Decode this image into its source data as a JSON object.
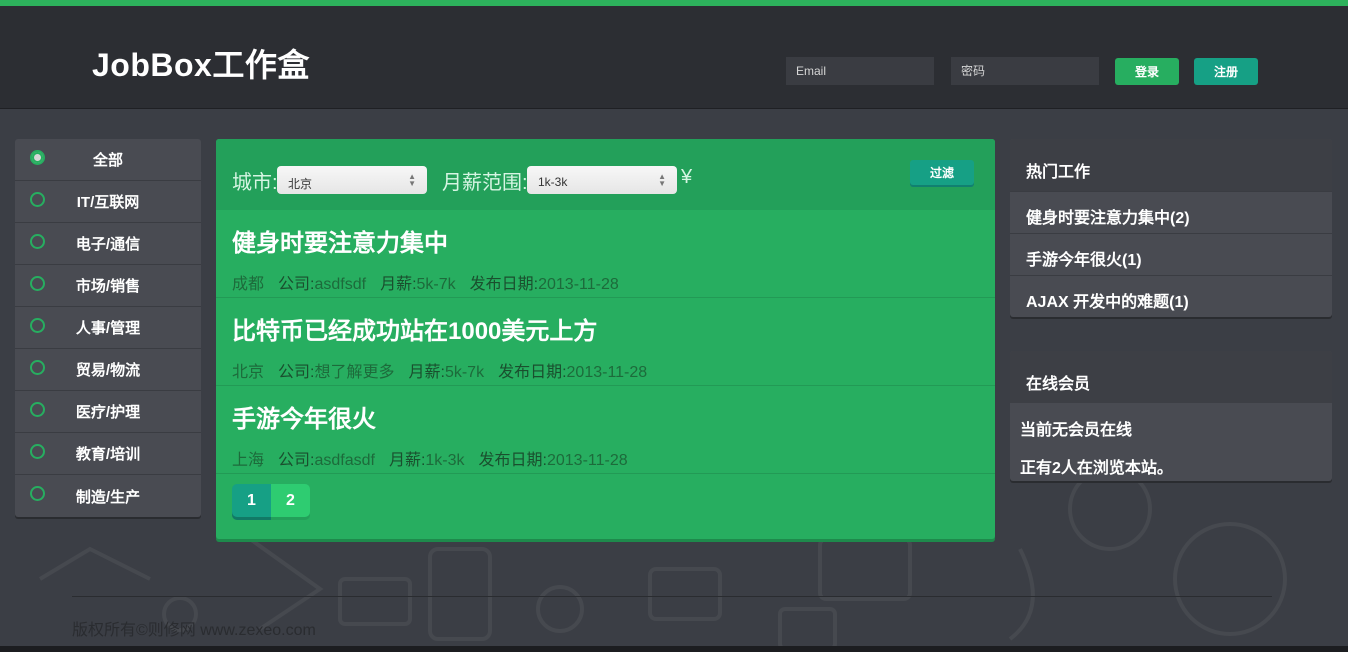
{
  "header": {
    "logo": "JobBox工作盒",
    "email_placeholder": "Email",
    "password_placeholder": "密码",
    "login_label": "登录",
    "register_label": "注册"
  },
  "sidebar": {
    "items": [
      {
        "label": "全部",
        "checked": true
      },
      {
        "label": "IT/互联网",
        "checked": false
      },
      {
        "label": "电子/通信",
        "checked": false
      },
      {
        "label": "市场/销售",
        "checked": false
      },
      {
        "label": "人事/管理",
        "checked": false
      },
      {
        "label": "贸易/物流",
        "checked": false
      },
      {
        "label": "医疗/护理",
        "checked": false
      },
      {
        "label": "教育/培训",
        "checked": false
      },
      {
        "label": "制造/生产",
        "checked": false
      }
    ]
  },
  "filter": {
    "city_label": "城市:",
    "city_value": "北京",
    "salary_label": "月薪范围:",
    "salary_value": "1k-3k",
    "currency": "¥",
    "filter_button": "过滤"
  },
  "jobs": [
    {
      "title": "健身时要注意力集中",
      "city": "成都",
      "company_key": "公司:",
      "company": "asdfsdf",
      "salary_key": "月薪:",
      "salary": "5k-7k",
      "date_key": "发布日期:",
      "date": "2013-11-28"
    },
    {
      "title": "比特币已经成功站在1000美元上方",
      "city": "北京",
      "company_key": "公司:",
      "company": "想了解更多",
      "salary_key": "月薪:",
      "salary": "5k-7k",
      "date_key": "发布日期:",
      "date": "2013-11-28"
    },
    {
      "title": "手游今年很火",
      "city": "上海",
      "company_key": "公司:",
      "company": "asdfasdf",
      "salary_key": "月薪:",
      "salary": "1k-3k",
      "date_key": "发布日期:",
      "date": "2013-11-28"
    }
  ],
  "pagination": {
    "pages": [
      "1",
      "2"
    ],
    "current": "1"
  },
  "hot_jobs": {
    "title": "热门工作",
    "items": [
      "健身时要注意力集中(2)",
      "手游今年很火(1)",
      "AJAX 开发中的难题(1)"
    ]
  },
  "online": {
    "title": "在线会员",
    "line1": "当前无会员在线",
    "line2": "正有2人在浏览本站。"
  },
  "footer": {
    "copyright": "版权所有©则修网 www.zexeo.com"
  },
  "colors": {
    "accent": "#27ae60",
    "teal": "#16a085",
    "background": "#3b3e45",
    "header": "#2c2e33"
  }
}
